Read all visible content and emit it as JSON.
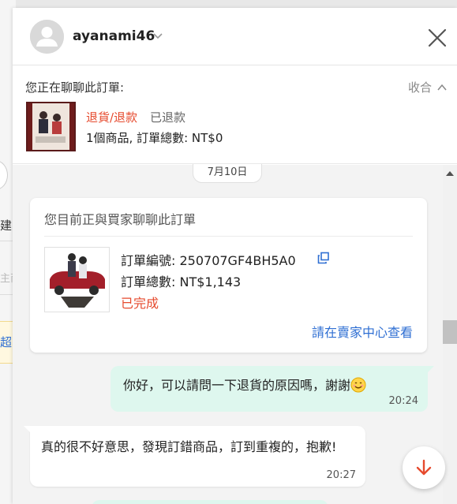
{
  "chat": {
    "username": "ayanami46",
    "close_label": "×"
  },
  "order_strip": {
    "chatting_label": "您正在聊聊此訂單:",
    "collapse_label": "收合",
    "return_tag": "退貨/退款",
    "return_status": "已退款",
    "summary": "1個商品, 訂單總數: NT$0"
  },
  "messages": {
    "date": "7月10日",
    "order_card": {
      "heading": "您目前正與買家聊聊此訂單",
      "order_no": "訂單編號: 250707GF4BH5A0",
      "order_total": "訂單總數: NT$1,143",
      "order_state": "已完成",
      "seller_link": "請在賣家中心查看"
    },
    "outgoing": {
      "text": "你好，可以請問一下退貨的原因嗎，謝謝",
      "time": "20:24"
    },
    "incoming": {
      "text": "真的很不好意思，發現訂錯商品，訂到重複的，抱歉!",
      "time": "20:27"
    }
  },
  "background": {
    "frag1": "建",
    "frag2": "主商",
    "frag3": "超"
  },
  "colors": {
    "accent": "#e64a2e",
    "link": "#2f6fd3",
    "outgoing_bubble": "#def7ee"
  }
}
